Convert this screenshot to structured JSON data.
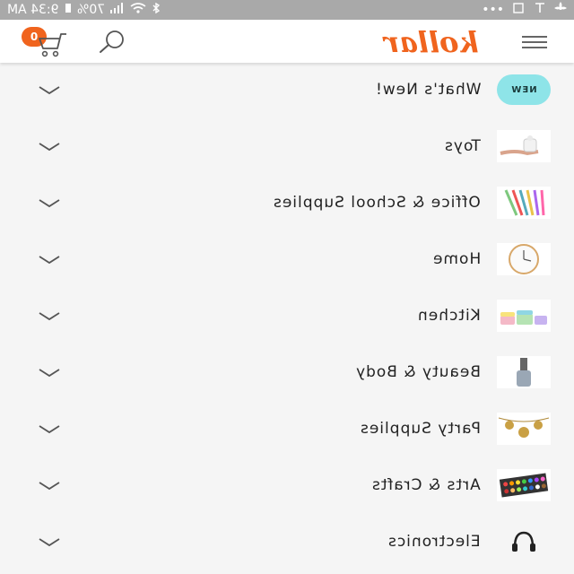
{
  "status_bar": {
    "time": "9:34 AM",
    "battery": "70%",
    "ellipsis": "•••"
  },
  "header": {
    "logo_text": "kollar",
    "cart_count": "0",
    "accent": "#f0641e"
  },
  "categories": [
    {
      "label": "What's New!",
      "thumb_text": "NEW",
      "icon": "new-badge"
    },
    {
      "label": "Toys",
      "icon": "toy-thumbnail"
    },
    {
      "label": "Office & School Supplies",
      "icon": "pens-thumbnail"
    },
    {
      "label": "Home",
      "icon": "clock-thumbnail"
    },
    {
      "label": "Kitchen",
      "icon": "containers-thumbnail"
    },
    {
      "label": "Beauty & Body",
      "icon": "nail-polish-thumbnail"
    },
    {
      "label": "Party Supplies",
      "icon": "party-thumbnail"
    },
    {
      "label": "Arts & Crafts",
      "icon": "paint-palette-thumbnail"
    },
    {
      "label": "Electronics",
      "icon": "headphones-icon"
    }
  ]
}
